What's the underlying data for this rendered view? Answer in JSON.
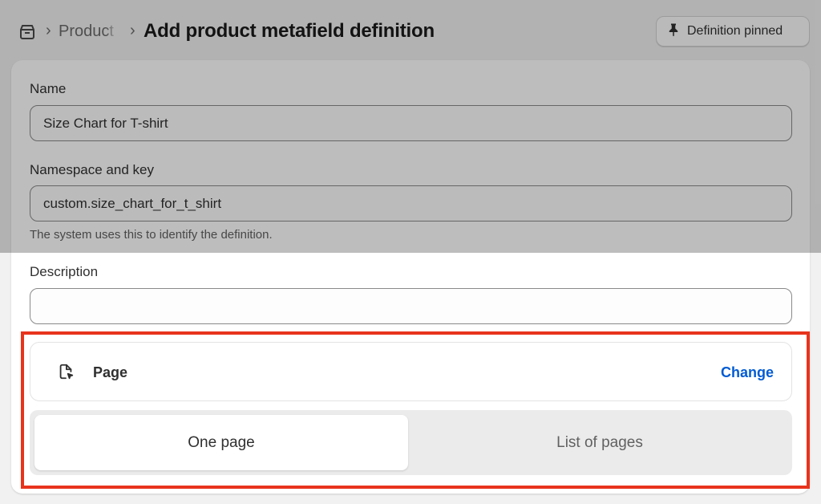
{
  "breadcrumb": {
    "home_icon": "store-icon",
    "separator": "›",
    "product": "Product"
  },
  "header": {
    "title": "Add product metafield definition",
    "pin_button_label": "Definition pinned",
    "pin_icon": "pin-icon"
  },
  "form": {
    "name": {
      "label": "Name",
      "value": "Size Chart for T-shirt"
    },
    "namespace_key": {
      "label": "Namespace and key",
      "value": "custom.size_chart_for_t_shirt",
      "help": "The system uses this to identify the definition."
    },
    "description": {
      "label": "Description",
      "value": ""
    }
  },
  "type": {
    "icon": "page-icon",
    "label": "Page",
    "change_label": "Change"
  },
  "segments": {
    "one_page": "One page",
    "list_of_pages": "List of pages",
    "selected": "One page"
  },
  "colors": {
    "highlight": "#e8331c",
    "link": "#005bd3"
  }
}
